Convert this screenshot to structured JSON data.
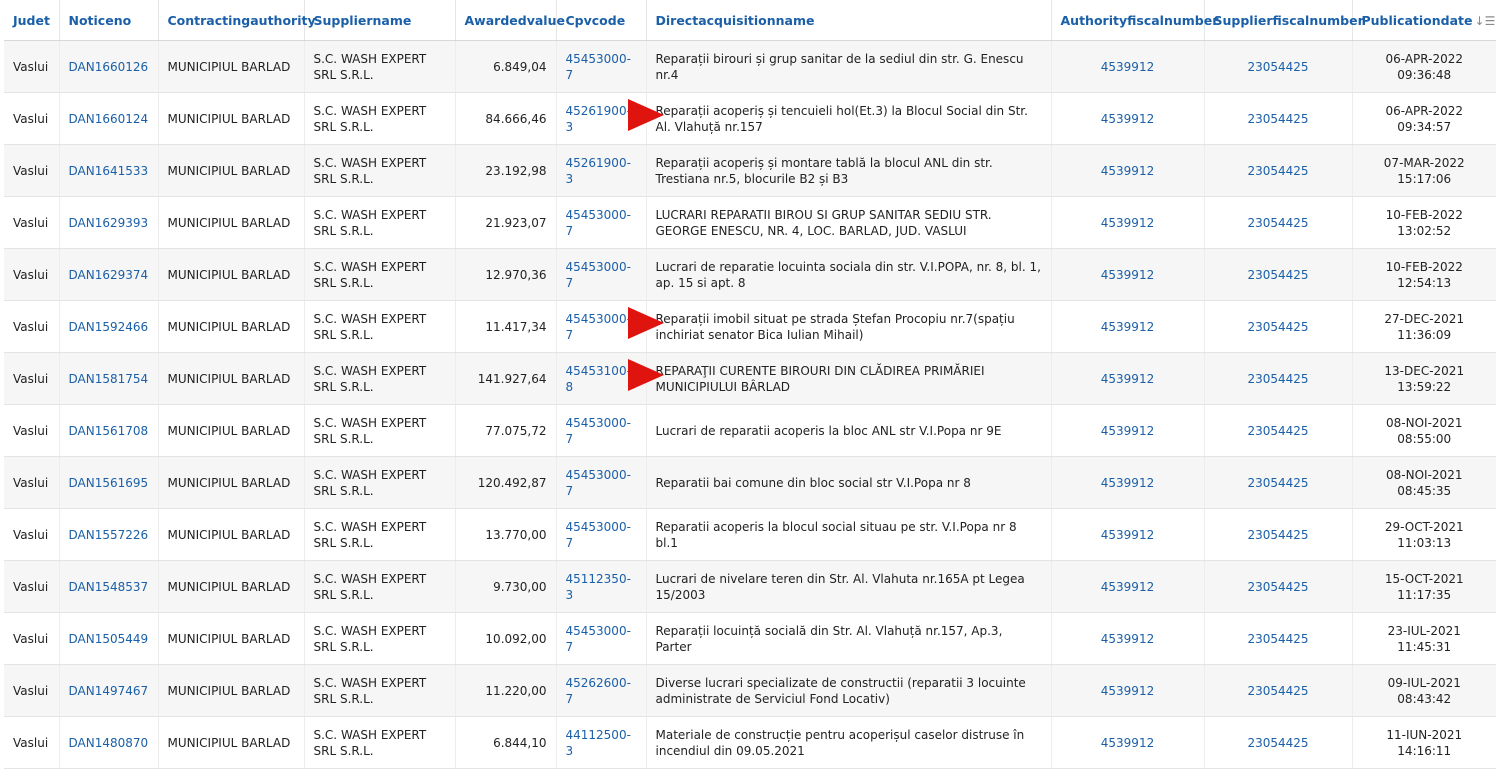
{
  "headers": {
    "judet": "Judet",
    "noticeno": "Noticeno",
    "authority": "Contractingauthority",
    "supplier": "Suppliername",
    "value": "Awardedvalue",
    "cpv": "Cpvcode",
    "name": "Directacquisitionname",
    "authfiscal": "Authorityfiscalnumber",
    "supfiscal": "Supplierfiscalnumber",
    "pubdate": "Publicationdate",
    "sort_glyph": "↓☰"
  },
  "rows": [
    {
      "judet": "Vaslui",
      "noticeno": "DAN1660126",
      "authority": "MUNICIPIUL BARLAD",
      "supplier": "S.C. WASH EXPERT SRL S.R.L.",
      "value": "6.849,04",
      "cpv": "45453000-7",
      "name": "Reparații birouri și grup sanitar de la sediul din str. G. Enescu nr.4",
      "authfiscal": "4539912",
      "supfiscal": "23054425",
      "date": "06-APR-2022",
      "time": "09:36:48"
    },
    {
      "judet": "Vaslui",
      "noticeno": "DAN1660124",
      "authority": "MUNICIPIUL BARLAD",
      "supplier": "S.C. WASH EXPERT SRL S.R.L.",
      "value": "84.666,46",
      "cpv": "45261900-3",
      "name": "Reparații acoperiș și tencuieli hol(Et.3) la Blocul Social din Str. Al. Vlahuță nr.157",
      "authfiscal": "4539912",
      "supfiscal": "23054425",
      "date": "06-APR-2022",
      "time": "09:34:57"
    },
    {
      "judet": "Vaslui",
      "noticeno": "DAN1641533",
      "authority": "MUNICIPIUL BARLAD",
      "supplier": "S.C. WASH EXPERT SRL S.R.L.",
      "value": "23.192,98",
      "cpv": "45261900-3",
      "name": "Reparații acoperiș și montare tablă la blocul ANL din str. Trestiana nr.5, blocurile B2 și B3",
      "authfiscal": "4539912",
      "supfiscal": "23054425",
      "date": "07-MAR-2022",
      "time": "15:17:06"
    },
    {
      "judet": "Vaslui",
      "noticeno": "DAN1629393",
      "authority": "MUNICIPIUL BARLAD",
      "supplier": "S.C. WASH EXPERT SRL S.R.L.",
      "value": "21.923,07",
      "cpv": "45453000-7",
      "name": "LUCRARI REPARATII BIROU SI GRUP SANITAR SEDIU STR. GEORGE ENESCU, NR. 4, LOC. BARLAD, JUD. VASLUI",
      "authfiscal": "4539912",
      "supfiscal": "23054425",
      "date": "10-FEB-2022",
      "time": "13:02:52"
    },
    {
      "judet": "Vaslui",
      "noticeno": "DAN1629374",
      "authority": "MUNICIPIUL BARLAD",
      "supplier": "S.C. WASH EXPERT SRL S.R.L.",
      "value": "12.970,36",
      "cpv": "45453000-7",
      "name": "Lucrari de reparatie locuinta sociala din str. V.I.POPA, nr. 8, bl. 1, ap. 15 si apt. 8",
      "authfiscal": "4539912",
      "supfiscal": "23054425",
      "date": "10-FEB-2022",
      "time": "12:54:13"
    },
    {
      "judet": "Vaslui",
      "noticeno": "DAN1592466",
      "authority": "MUNICIPIUL BARLAD",
      "supplier": "S.C. WASH EXPERT SRL S.R.L.",
      "value": "11.417,34",
      "cpv": "45453000-7",
      "name": "Reparații imobil situat pe strada Ștefan Procopiu nr.7(spațiu inchiriat senator Bica Iulian Mihail)",
      "authfiscal": "4539912",
      "supfiscal": "23054425",
      "date": "27-DEC-2021",
      "time": "11:36:09"
    },
    {
      "judet": "Vaslui",
      "noticeno": "DAN1581754",
      "authority": "MUNICIPIUL BARLAD",
      "supplier": "S.C. WASH EXPERT SRL S.R.L.",
      "value": "141.927,64",
      "cpv": "45453100-8",
      "name": "REPARAŢII CURENTE BIROURI DIN CLĂDIREA PRIMĂRIEI MUNICIPIULUI BÂRLAD",
      "authfiscal": "4539912",
      "supfiscal": "23054425",
      "date": "13-DEC-2021",
      "time": "13:59:22"
    },
    {
      "judet": "Vaslui",
      "noticeno": "DAN1561708",
      "authority": "MUNICIPIUL BARLAD",
      "supplier": "S.C. WASH EXPERT SRL S.R.L.",
      "value": "77.075,72",
      "cpv": "45453000-7",
      "name": "Lucrari de reparatii acoperis la bloc ANL str V.I.Popa nr 9E",
      "authfiscal": "4539912",
      "supfiscal": "23054425",
      "date": "08-NOI-2021",
      "time": "08:55:00"
    },
    {
      "judet": "Vaslui",
      "noticeno": "DAN1561695",
      "authority": "MUNICIPIUL BARLAD",
      "supplier": "S.C. WASH EXPERT SRL S.R.L.",
      "value": "120.492,87",
      "cpv": "45453000-7",
      "name": "Reparatii bai comune din bloc social str V.I.Popa nr 8",
      "authfiscal": "4539912",
      "supfiscal": "23054425",
      "date": "08-NOI-2021",
      "time": "08:45:35"
    },
    {
      "judet": "Vaslui",
      "noticeno": "DAN1557226",
      "authority": "MUNICIPIUL BARLAD",
      "supplier": "S.C. WASH EXPERT SRL S.R.L.",
      "value": "13.770,00",
      "cpv": "45453000-7",
      "name": "Reparatii acoperis la blocul social situau pe str. V.I.Popa nr 8 bl.1",
      "authfiscal": "4539912",
      "supfiscal": "23054425",
      "date": "29-OCT-2021",
      "time": "11:03:13"
    },
    {
      "judet": "Vaslui",
      "noticeno": "DAN1548537",
      "authority": "MUNICIPIUL BARLAD",
      "supplier": "S.C. WASH EXPERT SRL S.R.L.",
      "value": "9.730,00",
      "cpv": "45112350-3",
      "name": "Lucrari de nivelare teren din Str. Al. Vlahuta nr.165A pt Legea 15/2003",
      "authfiscal": "4539912",
      "supfiscal": "23054425",
      "date": "15-OCT-2021",
      "time": "11:17:35"
    },
    {
      "judet": "Vaslui",
      "noticeno": "DAN1505449",
      "authority": "MUNICIPIUL BARLAD",
      "supplier": "S.C. WASH EXPERT SRL S.R.L.",
      "value": "10.092,00",
      "cpv": "45453000-7",
      "name": "Reparații locuință socială din Str. Al. Vlahuță nr.157, Ap.3, Parter",
      "authfiscal": "4539912",
      "supfiscal": "23054425",
      "date": "23-IUL-2021",
      "time": "11:45:31"
    },
    {
      "judet": "Vaslui",
      "noticeno": "DAN1497467",
      "authority": "MUNICIPIUL BARLAD",
      "supplier": "S.C. WASH EXPERT SRL S.R.L.",
      "value": "11.220,00",
      "cpv": "45262600-7",
      "name": "Diverse lucrari specializate de constructii (reparatii 3 locuinte administrate de Serviciul Fond Locativ)",
      "authfiscal": "4539912",
      "supfiscal": "23054425",
      "date": "09-IUL-2021",
      "time": "08:43:42"
    },
    {
      "judet": "Vaslui",
      "noticeno": "DAN1480870",
      "authority": "MUNICIPIUL BARLAD",
      "supplier": "S.C. WASH EXPERT SRL S.R.L.",
      "value": "6.844,10",
      "cpv": "44112500-3",
      "name": "Materiale de construcție pentru acoperișul caselor distruse în incendiul din 09.05.2021",
      "authfiscal": "4539912",
      "supfiscal": "23054425",
      "date": "11-IUN-2021",
      "time": "14:16:11"
    }
  ],
  "annotations": {
    "color": "#e0140f",
    "arrow_rows": [
      1,
      5,
      6
    ]
  }
}
